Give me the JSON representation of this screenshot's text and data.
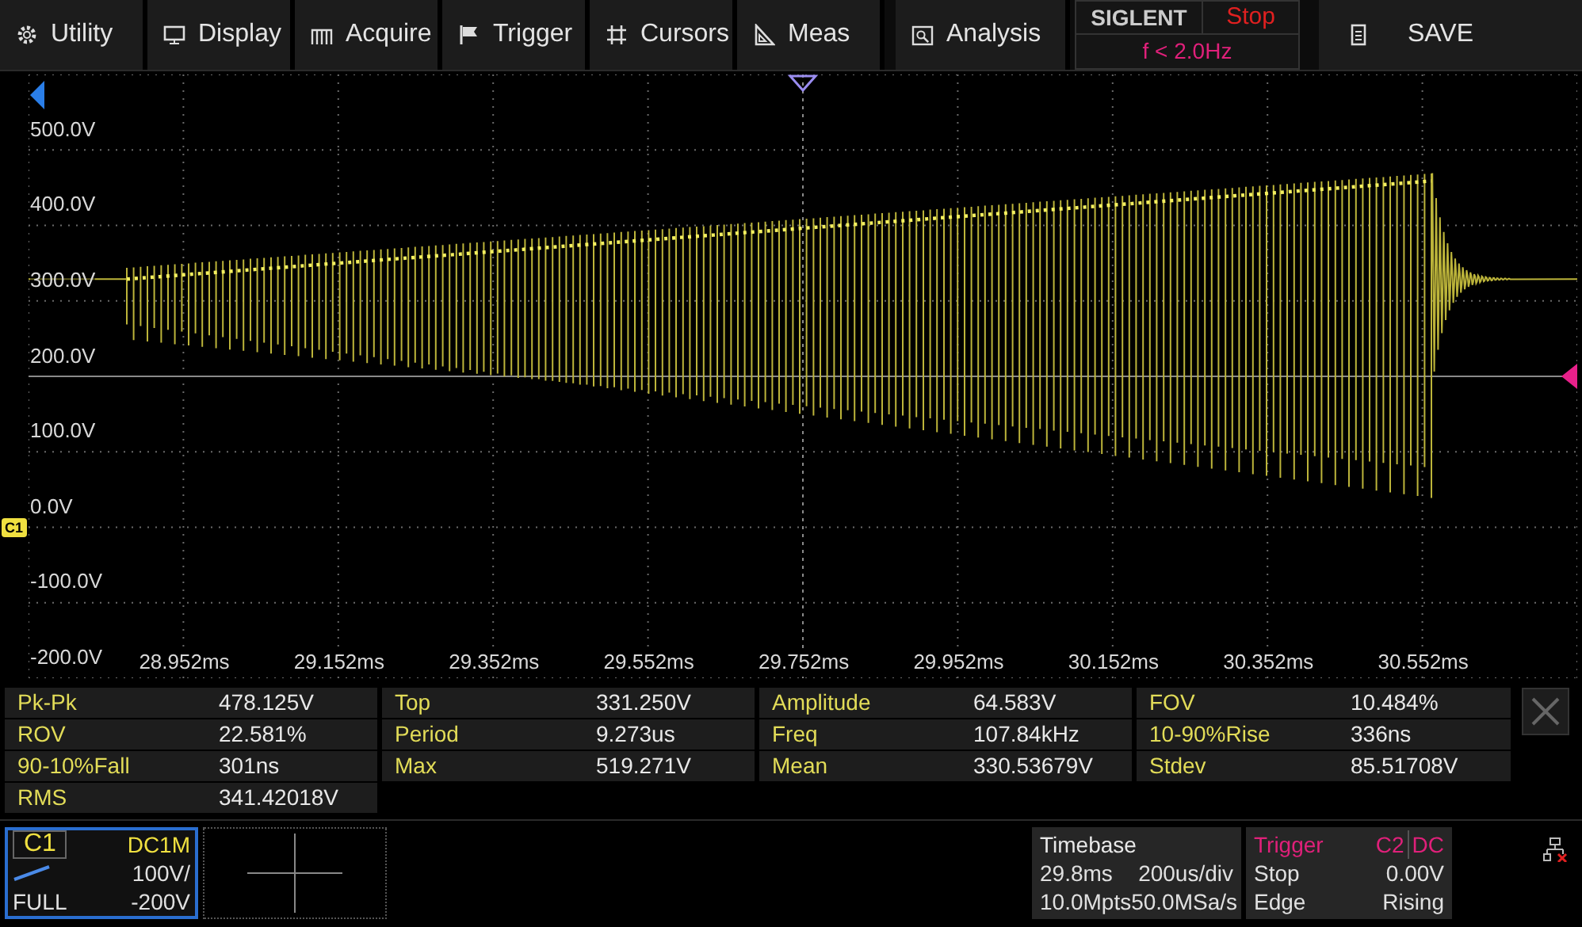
{
  "menu": [
    {
      "label": "Utility"
    },
    {
      "label": "Display"
    },
    {
      "label": "Acquire"
    },
    {
      "label": "Trigger"
    },
    {
      "label": "Cursors"
    },
    {
      "label": "Meas"
    },
    {
      "label": "Analysis"
    }
  ],
  "status": {
    "brand": "SIGLENT",
    "state": "Stop",
    "frequency": "f < 2.0Hz"
  },
  "save": "SAVE",
  "plot": {
    "y_labels": [
      "500.0V",
      "400.0V",
      "300.0V",
      "200.0V",
      "100.0V",
      "0.0V",
      "-100.0V",
      "-200.0V"
    ],
    "x_labels": [
      "28.952ms",
      "29.152ms",
      "29.352ms",
      "29.552ms",
      "29.752ms",
      "29.952ms",
      "30.152ms",
      "30.352ms",
      "30.552ms"
    ],
    "channel_tag": "C1"
  },
  "measurements": [
    {
      "label": "Pk-Pk",
      "value": "478.125V"
    },
    {
      "label": "Top",
      "value": "331.250V"
    },
    {
      "label": "Amplitude",
      "value": "64.583V"
    },
    {
      "label": "FOV",
      "value": "10.484%"
    },
    {
      "label": "ROV",
      "value": "22.581%"
    },
    {
      "label": "Period",
      "value": "9.273us"
    },
    {
      "label": "Freq",
      "value": "107.84kHz"
    },
    {
      "label": "10-90%Rise",
      "value": "336ns"
    },
    {
      "label": "90-10%Fall",
      "value": "301ns"
    },
    {
      "label": "Max",
      "value": "519.271V"
    },
    {
      "label": "Mean",
      "value": "330.53679V"
    },
    {
      "label": "Stdev",
      "value": "85.51708V"
    },
    {
      "label": "RMS",
      "value": "341.42018V"
    }
  ],
  "channel": {
    "name": "C1",
    "selected": true,
    "coupling": "DC1M",
    "scale": "100V/",
    "bandwidth": "FULL",
    "offset": "-200V"
  },
  "timebase": {
    "title": "Timebase",
    "delay": "29.8ms",
    "scale": "200us/div",
    "memory": "10.0Mpts",
    "rate": "50.0MSa/s"
  },
  "trigger": {
    "title": "Trigger",
    "source": "C2",
    "coupling": "DC",
    "state": "Stop",
    "level": "0.00V",
    "type": "Edge",
    "slope": "Rising"
  }
}
